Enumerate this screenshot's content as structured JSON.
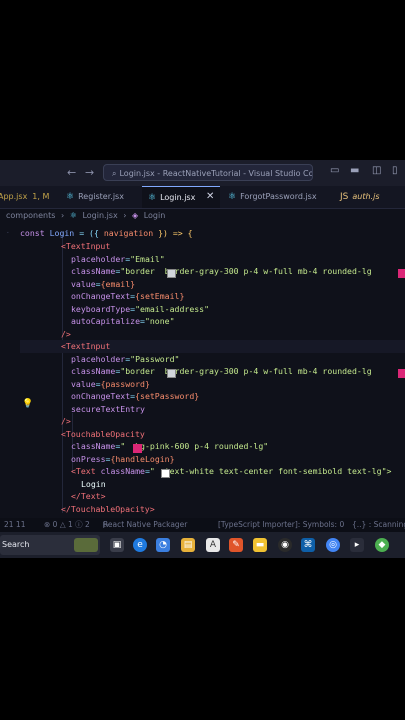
{
  "window": {
    "title": "Login.jsx - ReactNativeTutorial - Visual Studio Code",
    "back_icon": "arrow-left-icon",
    "forward_icon": "arrow-right-icon"
  },
  "tabs": [
    {
      "label": "App.jsx",
      "modifier": "1, M"
    },
    {
      "label": "Register.jsx"
    },
    {
      "label": "Login.jsx",
      "active": true
    },
    {
      "label": "ForgotPassword.jsx"
    },
    {
      "label": "auth.js"
    }
  ],
  "breadcrumb": {
    "folder": "components",
    "file": "Login.jsx",
    "symbol": "Login"
  },
  "code": {
    "l1": {
      "kw": "const",
      "name": "Login",
      "eq": "= ({",
      "param": "navigation",
      "rest": "}) => {"
    },
    "ti1": {
      "open": "<TextInput",
      "placeholder_attr": "placeholder",
      "placeholder_val": "\"Email\"",
      "class_attr": "className",
      "class_val": "\"border  border-gray-300 p-4 w-full mb-4 rounded-lg",
      "value_attr": "value",
      "value_val": "{email}",
      "change_attr": "onChangeText",
      "change_val": "{setEmail}",
      "kb_attr": "keyboardType",
      "kb_val": "\"email-address\"",
      "cap_attr": "autoCapitalize",
      "cap_val": "\"none\"",
      "close": "/>"
    },
    "ti2": {
      "open": "<TextInput",
      "placeholder_attr": "placeholder",
      "placeholder_val": "\"Password\"",
      "class_attr": "className",
      "class_val": "\"border  border-gray-300 p-4 w-full mb-4 rounded-lg",
      "value_attr": "value",
      "value_val": "{password}",
      "change_attr": "onChangeText",
      "change_val": "{setPassword}",
      "secure_attr": "secureTextEntry",
      "close": "/>"
    },
    "to": {
      "open": "<TouchableOpacity",
      "class_attr": "className",
      "class_val": "\"  bg-pink-600 p-4 rounded-lg\"",
      "press_attr": "onPress",
      "press_val": "{handleLogin}",
      "text_open": "<Text",
      "text_class_attr": "className",
      "text_class_val": "\"  text-white text-center font-semibold text-lg\">",
      "label": "Login",
      "text_close": "</Text>",
      "close": "</TouchableOpacity>"
    }
  },
  "status": {
    "branch": "21 11",
    "problems": "⊗ 0 △ 1 ⓘ 2",
    "packager": "React Native Packager",
    "importer": "[TypeScript Importer]: Symbols: 0",
    "scanning": "{..} : Scanning..."
  },
  "taskbar": {
    "search": "Search"
  },
  "colors": {
    "accent": "#82aaff",
    "bg": "#0f111a",
    "pink": "#db2777",
    "gray300": "#d1d5db",
    "white": "#ffffff"
  }
}
